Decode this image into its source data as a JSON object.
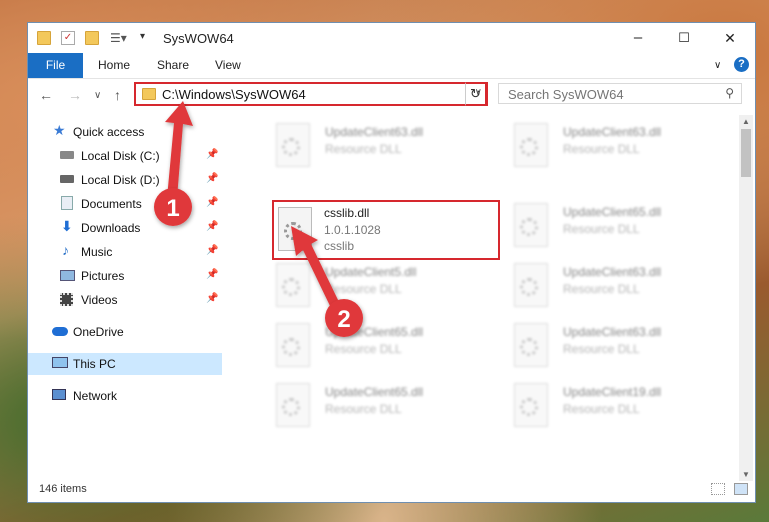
{
  "window": {
    "title": "SysWOW64",
    "controls": {
      "minimize": "–",
      "maximize": "☐",
      "close": "✕"
    }
  },
  "ribbon": {
    "tabs": [
      "File",
      "Home",
      "Share",
      "View"
    ],
    "help": "?"
  },
  "address": {
    "path": "C:\\Windows\\SysWOW64",
    "search_placeholder": "Search SysWOW64"
  },
  "sidebar": {
    "items": [
      {
        "label": "Quick access",
        "icon": "star-icon",
        "pinned": false
      },
      {
        "label": "Local Disk (C:)",
        "icon": "drive-icon",
        "pinned": true
      },
      {
        "label": "Local Disk (D:)",
        "icon": "drive-icon",
        "pinned": true
      },
      {
        "label": "Documents",
        "icon": "documents-icon",
        "pinned": true
      },
      {
        "label": "Downloads",
        "icon": "download-icon",
        "pinned": true
      },
      {
        "label": "Music",
        "icon": "music-icon",
        "pinned": true
      },
      {
        "label": "Pictures",
        "icon": "pictures-icon",
        "pinned": true
      },
      {
        "label": "Videos",
        "icon": "videos-icon",
        "pinned": true
      },
      {
        "label": "OneDrive",
        "icon": "cloud-icon",
        "pinned": false
      },
      {
        "label": "This PC",
        "icon": "computer-icon",
        "pinned": false,
        "selected": true
      },
      {
        "label": "Network",
        "icon": "network-icon",
        "pinned": false
      }
    ]
  },
  "files": [
    {
      "name": "UpdateClient63.dll",
      "type": "Resource DLL"
    },
    {
      "name": "UpdateClient63.dll",
      "type": "Resource DLL"
    },
    {
      "name": "UpdateClient65.dll",
      "type": "Resource DLL"
    },
    {
      "name": "UpdateClient5.dll",
      "type": "Resource DLL"
    },
    {
      "name": "UpdateClient63.dll",
      "type": "Resource DLL"
    },
    {
      "name": "UpdateClient65.dll",
      "type": "Resource DLL"
    },
    {
      "name": "UpdateClient63.dll",
      "type": "Resource DLL"
    },
    {
      "name": "UpdateClient65.dll",
      "type": "Resource DLL"
    },
    {
      "name": "UpdateClient19.dll",
      "type": "Resource DLL"
    }
  ],
  "selected_file": {
    "name": "csslib.dll",
    "version": "1.0.1.1028",
    "description": "csslib"
  },
  "status": {
    "item_count": "146 items"
  },
  "annotations": {
    "step1": "1",
    "step2": "2",
    "highlight_color": "#d6282e"
  }
}
